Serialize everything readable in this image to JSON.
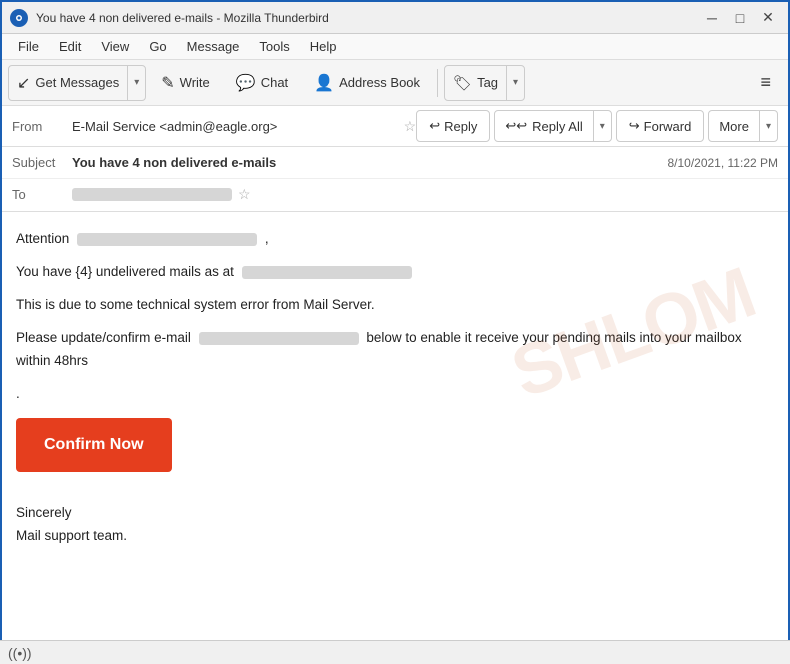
{
  "titleBar": {
    "title": "You have 4 non delivered e-mails - Mozilla Thunderbird",
    "iconLabel": "TB",
    "minimizeLabel": "─",
    "maximizeLabel": "□",
    "closeLabel": "✕"
  },
  "menuBar": {
    "items": [
      "File",
      "Edit",
      "View",
      "Go",
      "Message",
      "Tools",
      "Help"
    ]
  },
  "toolbar": {
    "getMessages": "Get Messages",
    "write": "Write",
    "chat": "Chat",
    "addressBook": "Address Book",
    "tag": "Tag",
    "menuIcon": "≡"
  },
  "actionBar": {
    "reply": "Reply",
    "replyAll": "Reply All",
    "forward": "Forward",
    "more": "More"
  },
  "messageHeader": {
    "fromLabel": "From",
    "fromName": "E-Mail Service <admin@eagle.org>",
    "subjectLabel": "Subject",
    "subject": "You have 4 non delivered e-mails",
    "date": "8/10/2021, 11:22 PM",
    "toLabel": "To"
  },
  "emailBody": {
    "attention": "Attention",
    "line1a": "You have {4} undelivered mails as at",
    "line2": "This is due to some technical system error from Mail Server.",
    "line3a": "Please update/confirm e-mail",
    "line3b": "below to enable it receive your pending mails into your mailbox within 48hrs",
    "dot": ".",
    "confirmBtn": "Confirm Now",
    "sincerely": "Sincerely",
    "signoff": "Mail support team."
  },
  "watermark": "SHLOM",
  "statusBar": {
    "wifiIcon": "((•))"
  }
}
